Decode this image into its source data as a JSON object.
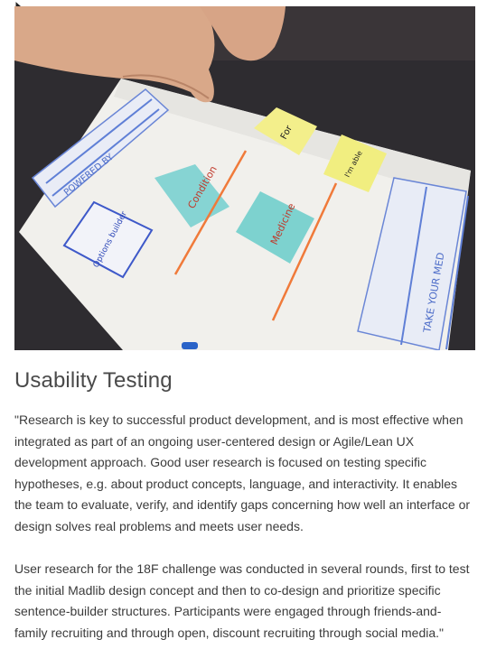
{
  "image": {
    "alt_icon": "whiteboard-photo",
    "sticky_notes": [
      "Condition",
      "Medicine",
      "For",
      "I'm able to take"
    ],
    "cards": [
      "Options builder",
      "POWERED BY",
      "TAKE YOUR MED"
    ]
  },
  "article": {
    "title": "Usability Testing",
    "paragraph1": "\"Research is key to successful product development, and is most effective when integrated as part of an ongoing user-centered design or Agile/Lean UX development approach. Good user research is focused on testing specific hypotheses, e.g. about product concepts, language, and interactivity. It enables the team to evaluate, verify, and identify gaps concerning how well an interface or design solves real problems and meets user needs.",
    "paragraph2": "User research for the 18F challenge was conducted in several rounds, first to test the initial Madlib design concept and then to co-design and prioritize specific sentence-builder structures. Participants were engaged through friends-and-family recruiting and through open, discount recruiting through social media.\""
  },
  "colors": {
    "title": "#4a4a4a",
    "body_text": "#3b3b3b",
    "sticky_yellow": "#f3f08a",
    "sticky_teal": "#7fd3d6",
    "orange_line": "#f07a3a"
  }
}
